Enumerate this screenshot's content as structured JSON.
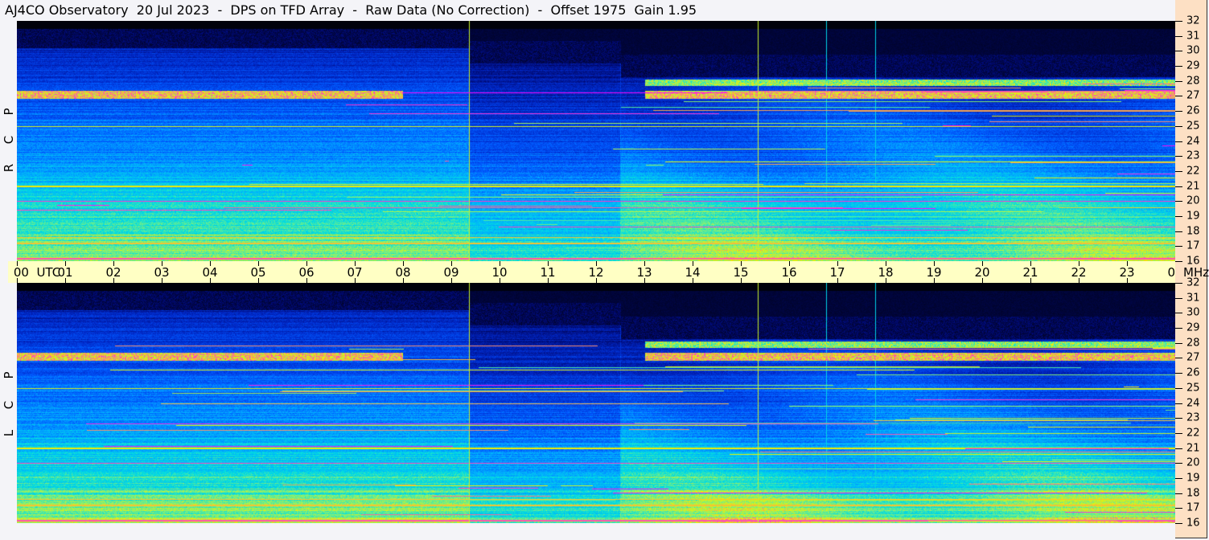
{
  "title": "AJ4CO Observatory  20 Jul 2023  -  DPS on TFD Array  -  Raw Data (No Correction)  -  Offset 1975  Gain 1.95",
  "panels": [
    {
      "name": "rcp",
      "label": [
        "R",
        "C",
        "P"
      ]
    },
    {
      "name": "lcp",
      "label": [
        "L",
        "C",
        "P"
      ]
    }
  ],
  "time_axis": {
    "labels": [
      "00  UTC",
      "01",
      "02",
      "03",
      "04",
      "05",
      "06",
      "07",
      "08",
      "09",
      "10",
      "11",
      "12",
      "13",
      "14",
      "15",
      "16",
      "17",
      "18",
      "19",
      "20",
      "21",
      "22",
      "23",
      "00"
    ],
    "unit_label": "MHz"
  },
  "freq_axis": {
    "labels": [
      "32",
      "31",
      "30",
      "29",
      "28",
      "27",
      "26",
      "25",
      "24",
      "23",
      "22",
      "21",
      "20",
      "19",
      "18",
      "17",
      "16"
    ]
  },
  "markers": {
    "green_hours": [
      9.35,
      15.35
    ],
    "cyan_hours": [
      16.75,
      17.75
    ]
  },
  "colors": {
    "time_axis_bg": "#ffffc4",
    "freq_axis_bg": "#fde0c4",
    "background": "#f4f4f8"
  }
}
